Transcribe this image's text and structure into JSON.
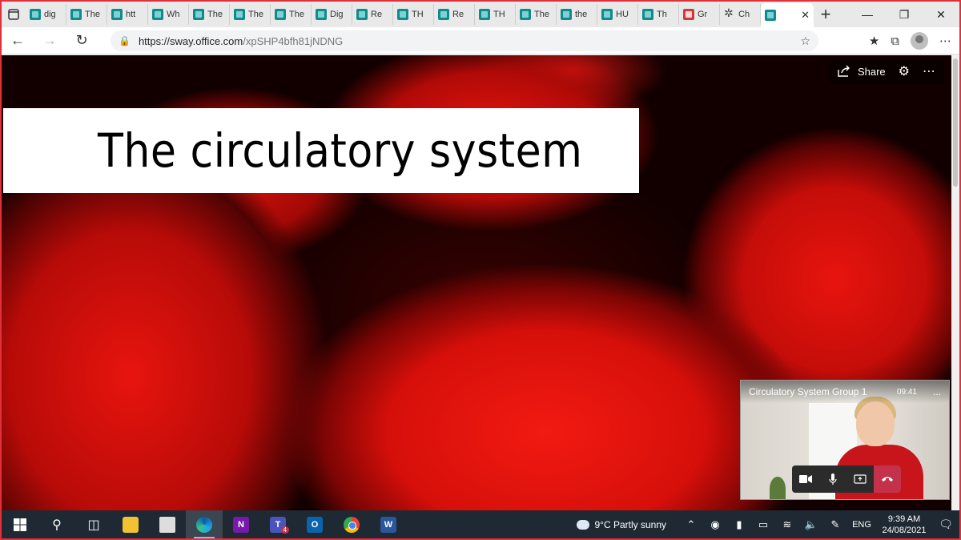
{
  "browser": {
    "tabs": [
      {
        "label": "dig",
        "kind": "sway"
      },
      {
        "label": "The",
        "kind": "sway"
      },
      {
        "label": "htt",
        "kind": "sway"
      },
      {
        "label": "Wh",
        "kind": "sway"
      },
      {
        "label": "The",
        "kind": "sway"
      },
      {
        "label": "The",
        "kind": "sway"
      },
      {
        "label": "The",
        "kind": "sway"
      },
      {
        "label": "Dig",
        "kind": "sway"
      },
      {
        "label": "Re",
        "kind": "sway"
      },
      {
        "label": "TH",
        "kind": "sway"
      },
      {
        "label": "Re",
        "kind": "sway"
      },
      {
        "label": "TH",
        "kind": "sway"
      },
      {
        "label": "The",
        "kind": "sway"
      },
      {
        "label": "the",
        "kind": "sway"
      },
      {
        "label": "HU",
        "kind": "sway"
      },
      {
        "label": "Th",
        "kind": "sway"
      },
      {
        "label": "Gr",
        "kind": "pdf"
      },
      {
        "label": "Ch",
        "kind": "star"
      }
    ],
    "active_tab_close": "✕",
    "new_tab": "+",
    "url_host": "https://sway.office.com",
    "url_path": "/xpSHP4bfh81jNDNG"
  },
  "sway": {
    "share_label": "Share",
    "title": "The circulatory system"
  },
  "teams": {
    "meeting_name": "Circulatory System Group 1",
    "elapsed": "09:41",
    "more": "..."
  },
  "taskbar": {
    "weather": "9°C  Partly sunny",
    "language": "ENG",
    "time": "9:39 AM",
    "date": "24/08/2021",
    "teams_badge": "4",
    "accent": "#7cc4f8"
  },
  "colors": {
    "frame_border": "#e0303a",
    "hangup": "#c4314b"
  }
}
